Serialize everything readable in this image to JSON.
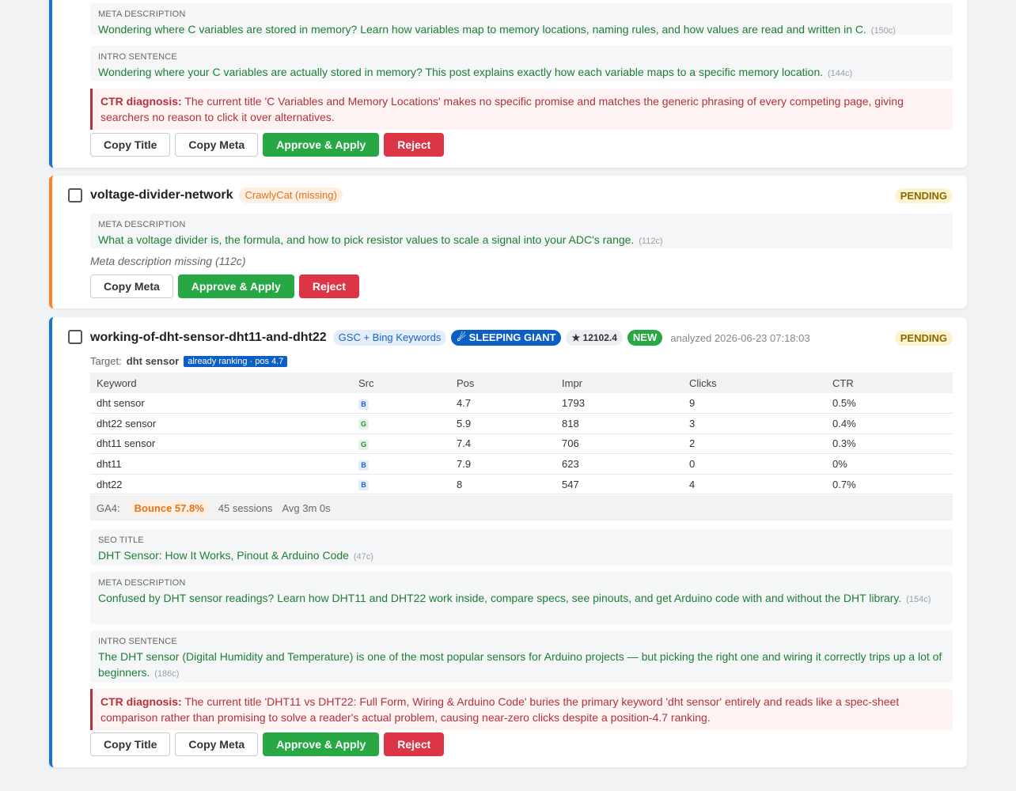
{
  "card1": {
    "meta": {
      "label": "META DESCRIPTION",
      "value": "Wondering where C variables are stored in memory? Learn how variables map to memory locations, naming rules, and how values are read and written in C.",
      "chars": "(150c)"
    },
    "intro": {
      "label": "INTRO SENTENCE",
      "value": "Wondering where your C variables are actually stored in memory? This post explains exactly how each variable maps to a specific memory location.",
      "chars": "(144c)"
    },
    "diagnosis": {
      "label": "CTR diagnosis:",
      "text": "The current title 'C Variables and Memory Locations' makes no specific promise and matches the generic phrasing of every competing page, giving searchers no reason to click it over alternatives."
    },
    "buttons": {
      "copy_title": "Copy Title",
      "copy_meta": "Copy Meta",
      "approve": "Approve & Apply",
      "reject": "Reject"
    }
  },
  "card2": {
    "slug": "voltage-divider-network",
    "source_badge": "CrawlyCat (missing)",
    "status": "PENDING",
    "meta": {
      "label": "META DESCRIPTION",
      "value": "What a voltage divider is, the formula, and how to pick resistor values to scale a signal into your ADC's range.",
      "chars": "(112c)"
    },
    "missing_note": "Meta description missing (112c)",
    "buttons": {
      "copy_meta": "Copy Meta",
      "approve": "Approve & Apply",
      "reject": "Reject"
    }
  },
  "card3": {
    "slug": "working-of-dht-sensor-dht11-and-dht22",
    "source_badge": "GSC + Bing Keywords",
    "giant_badge": "SLEEPING GIANT",
    "score_badge": "★ 12102.4",
    "new_badge": "NEW",
    "analyzed": "analyzed 2026-06-23 07:18:03",
    "status": "PENDING",
    "target_label": "Target:",
    "target_keyword": "dht sensor",
    "ranking_badge": "already ranking · pos 4.7",
    "table": {
      "headers": [
        "Keyword",
        "Src",
        "Pos",
        "Impr",
        "Clicks",
        "CTR"
      ],
      "rows": [
        {
          "keyword": "dht sensor",
          "src": "B",
          "pos": "4.7",
          "impr": "1793",
          "clicks": "9",
          "ctr": "0.5%"
        },
        {
          "keyword": "dht22 sensor",
          "src": "G",
          "pos": "5.9",
          "impr": "818",
          "clicks": "3",
          "ctr": "0.4%"
        },
        {
          "keyword": "dht11 sensor",
          "src": "G",
          "pos": "7.4",
          "impr": "706",
          "clicks": "2",
          "ctr": "0.3%"
        },
        {
          "keyword": "dht11",
          "src": "B",
          "pos": "7.9",
          "impr": "623",
          "clicks": "0",
          "ctr": "0%"
        },
        {
          "keyword": "dht22",
          "src": "B",
          "pos": "8",
          "impr": "547",
          "clicks": "4",
          "ctr": "0.7%"
        }
      ]
    },
    "ga4": {
      "label": "GA4:",
      "bounce": "Bounce 57.8%",
      "sessions": "45 sessions",
      "avg": "Avg 3m 0s"
    },
    "seo_title": {
      "label": "SEO TITLE",
      "value": "DHT Sensor: How It Works, Pinout & Arduino Code",
      "chars": "(47c)"
    },
    "meta": {
      "label": "META DESCRIPTION",
      "value": "Confused by DHT sensor readings? Learn how DHT11 and DHT22 work inside, compare specs, see pinouts, and get Arduino code with and without the DHT library.",
      "chars": "(154c)"
    },
    "intro": {
      "label": "INTRO SENTENCE",
      "value": "The DHT sensor (Digital Humidity and Temperature) is one of the most popular sensors for Arduino projects — but picking the right one and wiring it correctly trips up a lot of beginners.",
      "chars": "(186c)"
    },
    "diagnosis": {
      "label": "CTR diagnosis:",
      "text": "The current title 'DHT11 vs DHT22: Full Form, Wiring & Arduino Code' buries the primary keyword 'dht sensor' entirely and reads like a spec-sheet comparison rather than promising to solve a reader's actual problem, causing near-zero clicks despite a position-4.7 ranking."
    },
    "buttons": {
      "copy_title": "Copy Title",
      "copy_meta": "Copy Meta",
      "approve": "Approve & Apply",
      "reject": "Reject"
    }
  }
}
